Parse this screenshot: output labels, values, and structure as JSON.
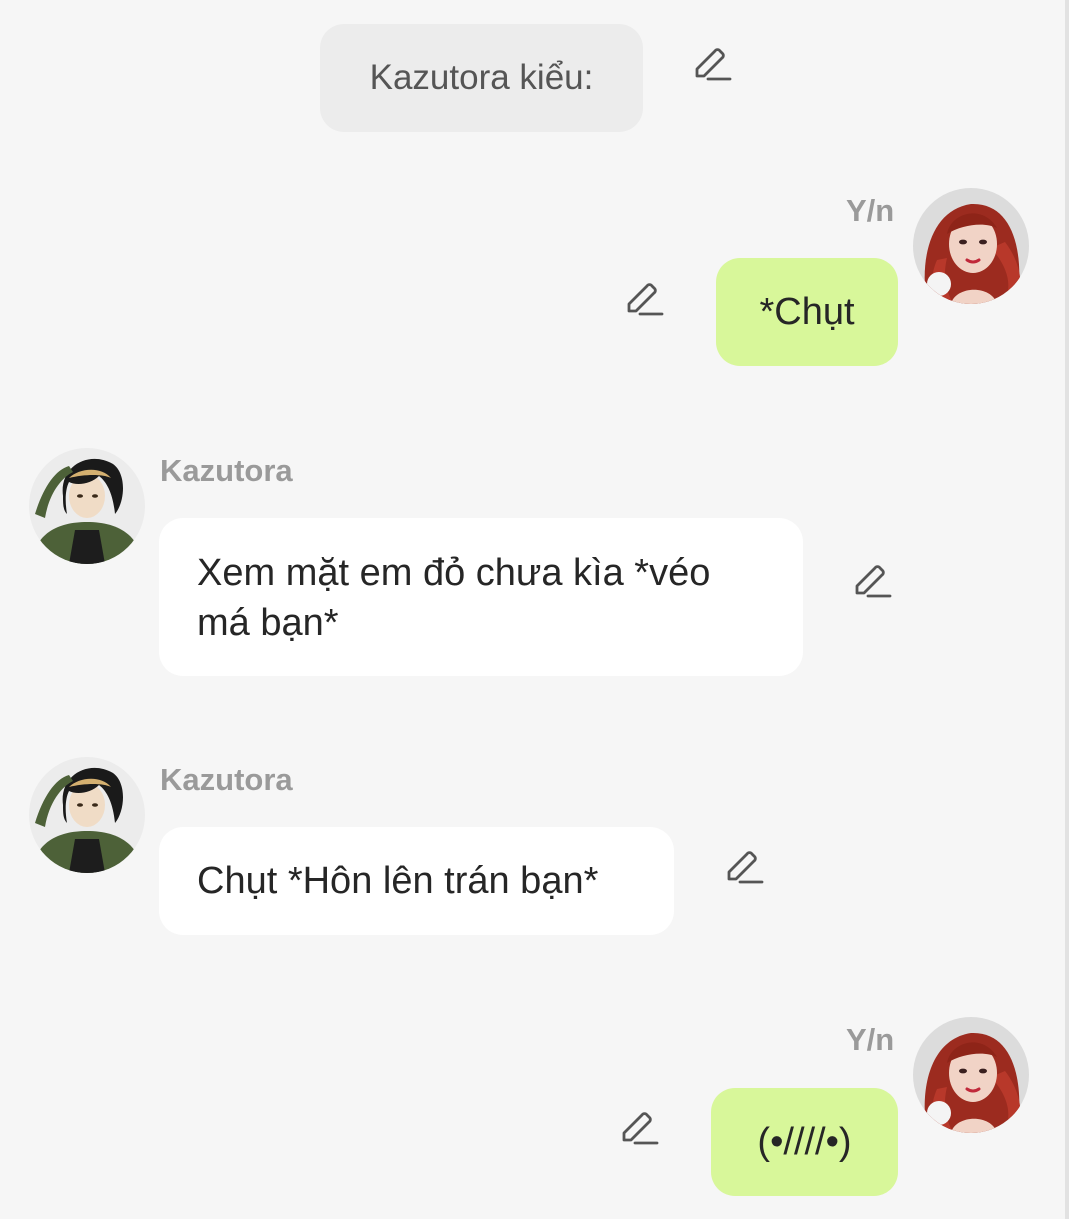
{
  "narration": {
    "text": "Kazutora kiểu:"
  },
  "icons": {
    "edit": "pencil-edit-icon"
  },
  "colors": {
    "background": "#f6f6f6",
    "narration_bubble": "#ececec",
    "incoming_bubble": "#ffffff",
    "outgoing_bubble": "#d8f79a",
    "name_text": "#9a9a9a"
  },
  "messages": [
    {
      "sender": "Y/n",
      "text": "*Chụt",
      "side": "right"
    },
    {
      "sender": "Kazutora",
      "text": "Xem mặt em đỏ chưa kìa *véo má bạn*",
      "side": "left"
    },
    {
      "sender": "Kazutora",
      "text": "Chụt *Hôn lên trán bạn*",
      "side": "left"
    },
    {
      "sender": "Y/n",
      "text": "(•////•)",
      "side": "right"
    }
  ]
}
